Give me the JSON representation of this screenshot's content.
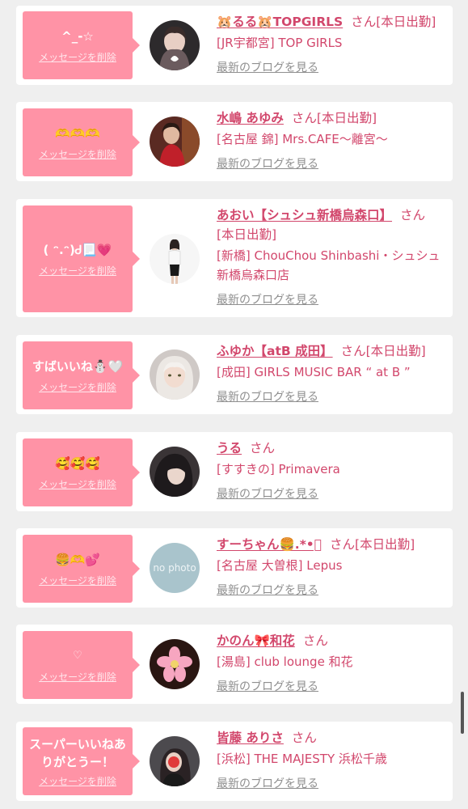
{
  "items": [
    {
      "message": "^_-☆",
      "delete_label": "メッセージを削除",
      "name": "🐹るる🐹TOPGIRLS",
      "san": "さん",
      "status": "[本日出勤]",
      "shop": "[JR宇都宮] TOP GIRLS",
      "blog_label": "最新のブログを見る"
    },
    {
      "message": "🫶🫶🫶",
      "delete_label": "メッセージを削除",
      "name": "水嶋 あゆみ",
      "san": "さん",
      "status": "[本日出勤]",
      "shop": "[名古屋 錦] Mrs.CAFE〜離宮〜",
      "blog_label": "最新のブログを見る"
    },
    {
      "message": "( ᵔ.ᵔ)Ꮷ📃💗",
      "delete_label": "メッセージを削除",
      "name": "あおい【シュシュ新橋烏森口】",
      "san": "さん",
      "status": "[本日出勤]",
      "shop": "[新橋] ChouChou Shinbashi・シュシュ新橋烏森口店",
      "blog_label": "最新のブログを見る"
    },
    {
      "message": "すばいいね⛄🤍",
      "delete_label": "メッセージを削除",
      "name": "ふゆか【atB 成田】",
      "san": "さん",
      "status": "[本日出勤]",
      "shop": "[成田] GIRLS MUSIC BAR “ at B ”",
      "blog_label": "最新のブログを見る"
    },
    {
      "message": "🥰🥰🥰",
      "delete_label": "メッセージを削除",
      "name": "うる",
      "san": "さん",
      "status": "",
      "shop": "[すすきの] Primavera",
      "blog_label": "最新のブログを見る"
    },
    {
      "message": "🍔🫶💕",
      "delete_label": "メッセージを削除",
      "name": "すーちゃん🍔.*•ﾟ",
      "san": "さん",
      "status": "[本日出勤]",
      "shop": "[名古屋 大曽根] Lepus",
      "blog_label": "最新のブログを見る",
      "avatar_text": "no photo"
    },
    {
      "message": "♡",
      "delete_label": "メッセージを削除",
      "name": "かのん🎀和花",
      "san": "さん",
      "status": "",
      "shop": "[湯島] club lounge 和花",
      "blog_label": "最新のブログを見る"
    },
    {
      "message": "スーパーいいねありがとうー！",
      "delete_label": "メッセージを削除",
      "name": "皆藤 ありさ",
      "san": "さん",
      "status": "",
      "shop": "[浜松] THE MAJESTY 浜松千歳",
      "blog_label": "最新のブログを見る"
    }
  ],
  "colors": {
    "pink_box": "#ff93a6",
    "name_pink": "#d2476c",
    "link_gray": "#8f8f8f",
    "background": "#efefef"
  }
}
